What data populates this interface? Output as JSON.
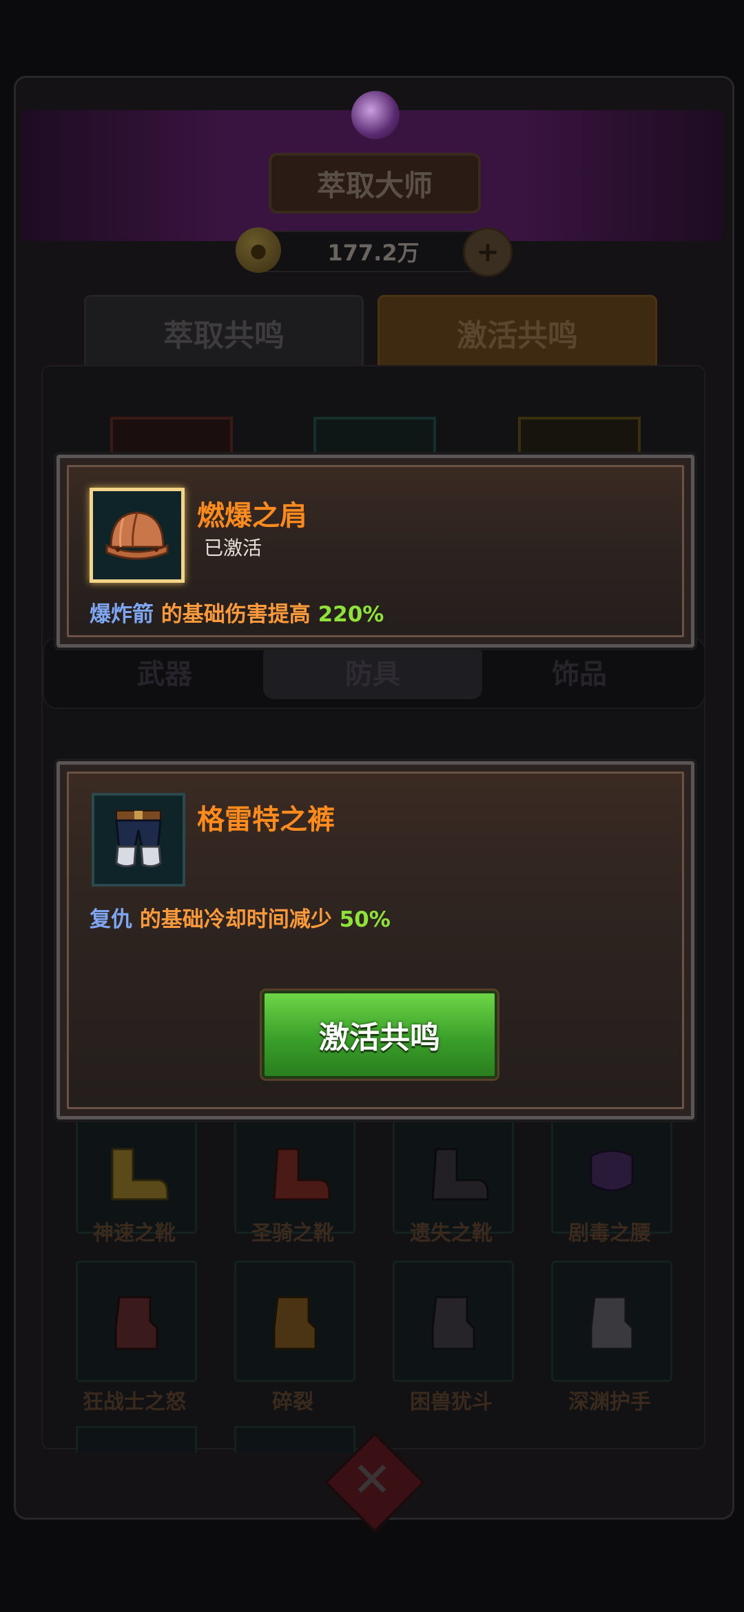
{
  "header": {
    "title": "萃取大师",
    "currency_amount": "177.2万"
  },
  "tabs": [
    {
      "label": "萃取共鸣",
      "active": false
    },
    {
      "label": "激活共鸣",
      "active": true
    }
  ],
  "segments": [
    {
      "label": "武器",
      "active": false
    },
    {
      "label": "防具",
      "active": true
    },
    {
      "label": "饰品",
      "active": false
    }
  ],
  "grid_items": [
    {
      "label": "神速之靴",
      "icon": "boots-gold-icon"
    },
    {
      "label": "圣骑之靴",
      "icon": "boots-red-icon"
    },
    {
      "label": "遗失之靴",
      "icon": "boots-dark-icon"
    },
    {
      "label": "剧毒之腰",
      "icon": "belt-purple-icon"
    },
    {
      "label": "狂战士之怒",
      "icon": "gauntlet-red-icon"
    },
    {
      "label": "碎裂",
      "icon": "gauntlet-gold-icon"
    },
    {
      "label": "困兽犹斗",
      "icon": "gauntlet-dark-icon"
    },
    {
      "label": "深渊护手",
      "icon": "gauntlet-white-icon"
    }
  ],
  "popup_activated": {
    "item_name": "燃爆之肩",
    "status": "已激活",
    "icon": "helmet-icon",
    "effect_skill": "爆炸箭",
    "effect_desc": "的基础伤害提高",
    "effect_value": "220%"
  },
  "popup_pending": {
    "item_name": "格雷特之裤",
    "icon": "pants-icon",
    "effect_skill": "复仇",
    "effect_desc": "的基础冷却时间减少",
    "effect_value": "50%",
    "button_label": "激活共鸣"
  },
  "colors": {
    "item_name": "#ff8a1e",
    "skill": "#7fa6f2",
    "desc": "#ff9a3c",
    "value": "#8ee23a",
    "button": "#3aa02a"
  }
}
